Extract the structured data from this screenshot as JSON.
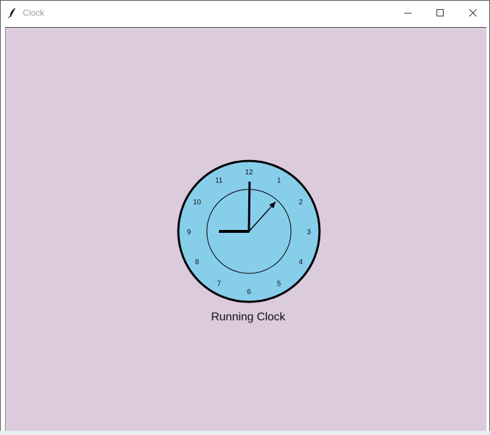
{
  "window": {
    "title": "Clock",
    "controls": {
      "minimize": "minimize-icon",
      "maximize": "maximize-icon",
      "close": "close-icon"
    }
  },
  "clock": {
    "numbers": [
      "12",
      "1",
      "2",
      "3",
      "4",
      "5",
      "6",
      "7",
      "8",
      "9",
      "10",
      "11"
    ],
    "time": {
      "hour": 9,
      "minute": 0,
      "second": 7
    },
    "face_color": "#87ceeb",
    "background_color": "#dccbdc"
  },
  "caption": "Running Clock"
}
